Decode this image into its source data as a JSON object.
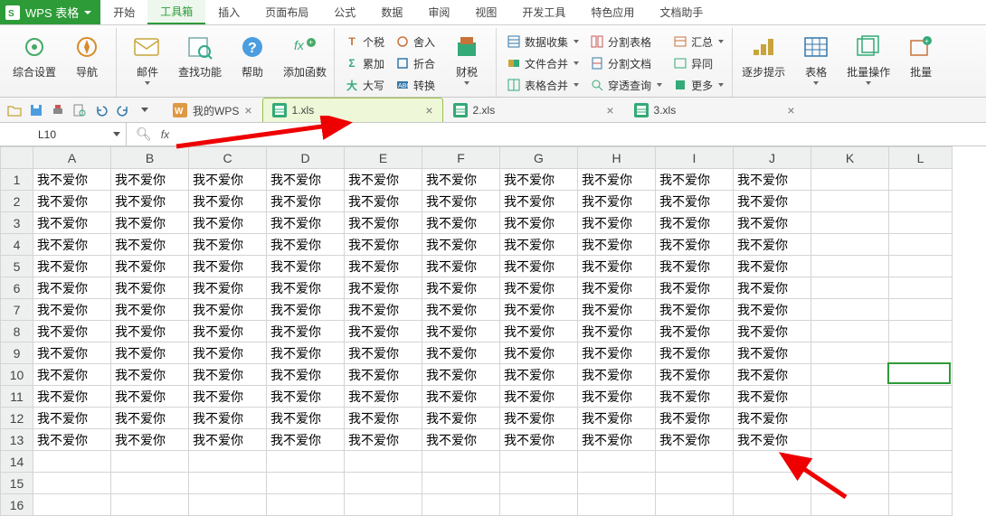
{
  "brand": "WPS 表格",
  "menu": {
    "items": [
      "开始",
      "工具箱",
      "插入",
      "页面布局",
      "公式",
      "数据",
      "审阅",
      "视图",
      "开发工具",
      "特色应用",
      "文档助手"
    ],
    "active": 1
  },
  "ribbon": {
    "g1": {
      "a": "综合设置",
      "b": "导航"
    },
    "g2": {
      "a": "邮件",
      "b": "查找功能",
      "c": "帮助",
      "d": "添加函数"
    },
    "g3": {
      "r1a": "个税",
      "r1b": "舍入",
      "r2a": "累加",
      "r2b": "折合",
      "r3a": "大写",
      "r3b": "转换",
      "col": "财税"
    },
    "g4": {
      "r1": "数据收集",
      "r1b": "分割表格",
      "r1c": "汇总",
      "r2": "文件合并",
      "r2b": "分割文档",
      "r2c": "异同",
      "r3": "表格合并",
      "r3b": "穿透查询",
      "r3c": "更多"
    },
    "g5": {
      "a": "逐步提示",
      "b": "表格",
      "c": "批量操作",
      "d": "批量"
    }
  },
  "tabs": {
    "home": "我的WPS",
    "files": [
      {
        "name": "1.xls",
        "active": true
      },
      {
        "name": "2.xls",
        "active": false
      },
      {
        "name": "3.xls",
        "active": false
      }
    ]
  },
  "namebox": "L10",
  "fx": "fx",
  "columns": [
    "A",
    "B",
    "C",
    "D",
    "E",
    "F",
    "G",
    "H",
    "I",
    "J",
    "K",
    "L"
  ],
  "rows": 16,
  "cell_text": "我不爱你",
  "data_rows": 13,
  "data_cols": 10,
  "sel": {
    "row": 10,
    "col": "L"
  }
}
